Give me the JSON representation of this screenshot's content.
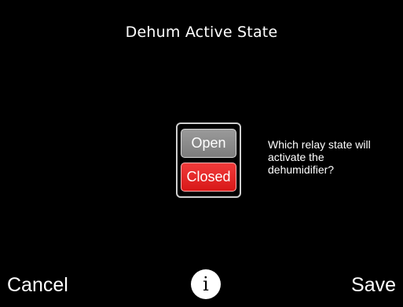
{
  "screen": {
    "title": "Dehum Active State",
    "question": "Which relay state will activate the dehumidifier?"
  },
  "options": {
    "open_label": "Open",
    "closed_label": "Closed",
    "selected": "Closed"
  },
  "footer": {
    "cancel_label": "Cancel",
    "info_glyph": "i",
    "save_label": "Save"
  },
  "colors": {
    "background": "#000000",
    "selected_option": "#e02424",
    "unselected_option": "#8a8a8a"
  }
}
